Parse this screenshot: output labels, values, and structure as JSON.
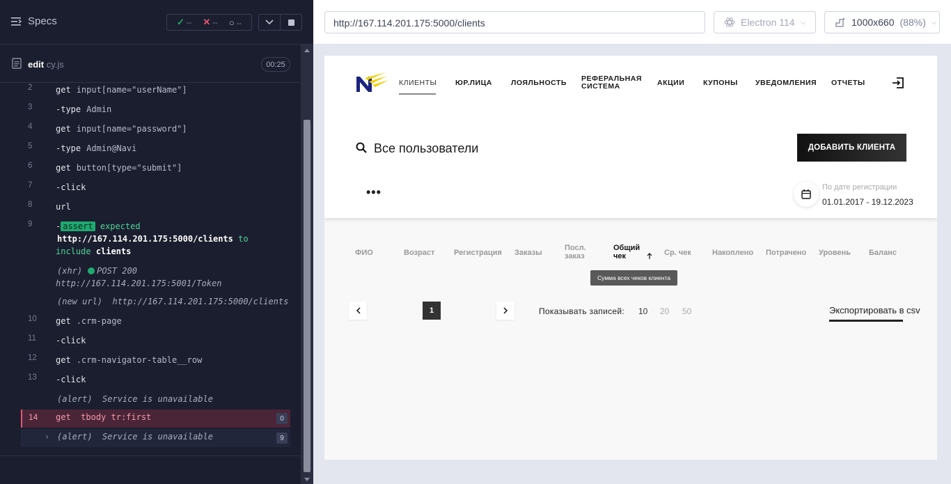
{
  "runner": {
    "specs_label": "Specs",
    "stats": {
      "passed": "--",
      "failed": "--",
      "pending": "--"
    },
    "spec_file": {
      "name": "edit",
      "ext": " cy.js"
    },
    "timer": "00:25",
    "commands": [
      {
        "num": "2",
        "name": "get",
        "arg": "input[name=\"userName\"]"
      },
      {
        "num": "3",
        "name": "-type",
        "arg": "Admin"
      },
      {
        "num": "4",
        "name": "get",
        "arg": "input[name=\"password\"]"
      },
      {
        "num": "5",
        "name": "-type",
        "arg": "Admin@Navi"
      },
      {
        "num": "6",
        "name": "get",
        "arg": "button[type=\"submit\"]"
      },
      {
        "num": "7",
        "name": "-click",
        "arg": ""
      },
      {
        "num": "8",
        "name": "url",
        "arg": ""
      }
    ],
    "assert": {
      "num": "9",
      "prefix": "-",
      "badge": "assert",
      "expected": "expected",
      "url": "http://167.114.201.175:5000/clients",
      "to": "to",
      "include": "include",
      "value": "clients"
    },
    "xhr": {
      "label": "(xhr)",
      "method": "POST 200",
      "url": "http://167.114.201.175:5001/Token"
    },
    "new_url": {
      "label": "(new url)",
      "url": "http://167.114.201.175:5000/clients"
    },
    "commands2": [
      {
        "num": "10",
        "name": "get",
        "arg": ".crm-page"
      },
      {
        "num": "11",
        "name": "-click",
        "arg": ""
      },
      {
        "num": "12",
        "name": "get",
        "arg": ".crm-navigator-table__row"
      },
      {
        "num": "13",
        "name": "-click",
        "arg": ""
      }
    ],
    "alert1": {
      "label": "(alert)",
      "text": "Service is unavailable"
    },
    "failed": {
      "num": "14",
      "name": "get",
      "arg": "tbody tr:first",
      "count": "0"
    },
    "alert2": {
      "label": "(alert)",
      "text": "Service is unavailable",
      "count": "9"
    }
  },
  "browser": {
    "url": "http://167.114.201.175:5000/clients",
    "engine": "Electron 114",
    "viewport": "1000x660",
    "zoom": "(88%)"
  },
  "app": {
    "nav": {
      "clients": "КЛИЕНТЫ",
      "legal": "ЮР.ЛИЦА",
      "loyalty": "ЛОЯЛЬНОСТЬ",
      "referral_1": "РЕФЕРАЛЬНАЯ",
      "referral_2": "СИСТЕМА",
      "promos": "АКЦИИ",
      "coupons": "КУПОНЫ",
      "notifications": "УВЕДОМЛЕНИЯ",
      "reports": "ОТЧЕТЫ"
    },
    "title": "Все пользователи",
    "add_button": "ДОБАВИТЬ КЛИЕНТА",
    "more": "•••",
    "date_filter": {
      "label": "По дате регистрации",
      "range": "01.01.2017 - 19.12.2023"
    },
    "columns": {
      "fio": "ФИО",
      "age": "Возраст",
      "registration": "Регистрация",
      "orders": "Заказы",
      "last_order_1": "Посл.",
      "last_order_2": "заказ",
      "total_check_1": "Общий",
      "total_check_2": "чек",
      "avg_check": "Ср. чек",
      "accumulated": "Накоплено",
      "spent": "Потрачено",
      "level": "Уровень",
      "balance": "Баланс"
    },
    "tooltip": "Сумма всех чеков клиента",
    "pagination": {
      "current": "1",
      "per_page_label": "Показывать записей:",
      "options": [
        "10",
        "20",
        "50"
      ]
    },
    "export": "Экспортировать в csv"
  },
  "colors": {
    "runner_bg": "#1b1e2e",
    "pass": "#1fa971",
    "fail": "#e45770",
    "logo_blue": "#1a237e",
    "logo_yellow": "#f5d000"
  }
}
